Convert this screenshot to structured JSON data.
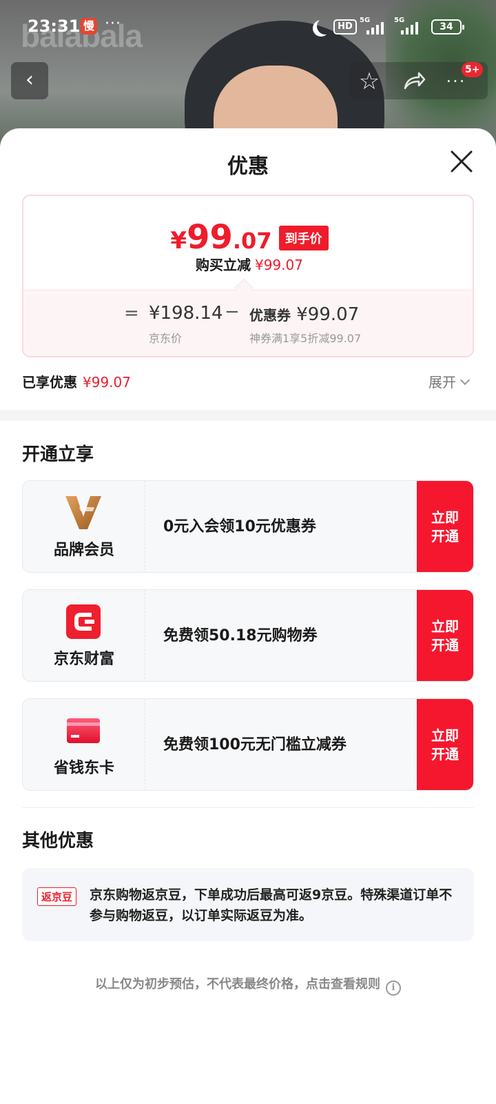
{
  "status_bar": {
    "time": "23:31",
    "app_badge": "慢",
    "more": "···",
    "hd": "HD",
    "net1": "5G",
    "net2": "5G",
    "battery": "34"
  },
  "background": {
    "brand_watermark": "balabala"
  },
  "nav": {
    "back": "‹",
    "more": "···",
    "badge": "5+"
  },
  "sheet": {
    "title": "优惠",
    "price": {
      "yen": "¥",
      "integer": "99",
      "decimal": ".07",
      "tag": "到手价",
      "reduce_label": "购买立减",
      "reduce_value": "¥99.07"
    },
    "breakdown": {
      "eq": "=",
      "jd_price": "¥198.14",
      "jd_label": "京东价",
      "minus": "−",
      "coupon_label": "优惠券",
      "coupon_value": "¥99.07",
      "coupon_desc": "神券满1享5折减99.07"
    },
    "enjoyed_label": "已享优惠",
    "enjoyed_value": "¥99.07",
    "expand": "展开"
  },
  "open_section": {
    "title": "开通立享",
    "offers": [
      {
        "name": "品牌会员",
        "desc": "0元入会领10元优惠券",
        "button": "立即开通"
      },
      {
        "name": "京东财富",
        "desc": "免费领50.18元购物券",
        "button": "立即开通"
      },
      {
        "name": "省钱东卡",
        "desc": "免费领100元无门槛立减券",
        "button": "立即开通"
      }
    ]
  },
  "other_section": {
    "title": "其他优惠",
    "tag": "返京豆",
    "text": "京东购物返京豆，下单成功后最高可返9京豆。特殊渠道订单不参与购物返豆，以订单实际返豆为准。"
  },
  "footer": {
    "note": "以上仅为初步预估，不代表最终价格，点击查看规则",
    "info": "i"
  },
  "colors": {
    "accent_red": "#ef1c2b",
    "button_red": "#f5172e"
  }
}
